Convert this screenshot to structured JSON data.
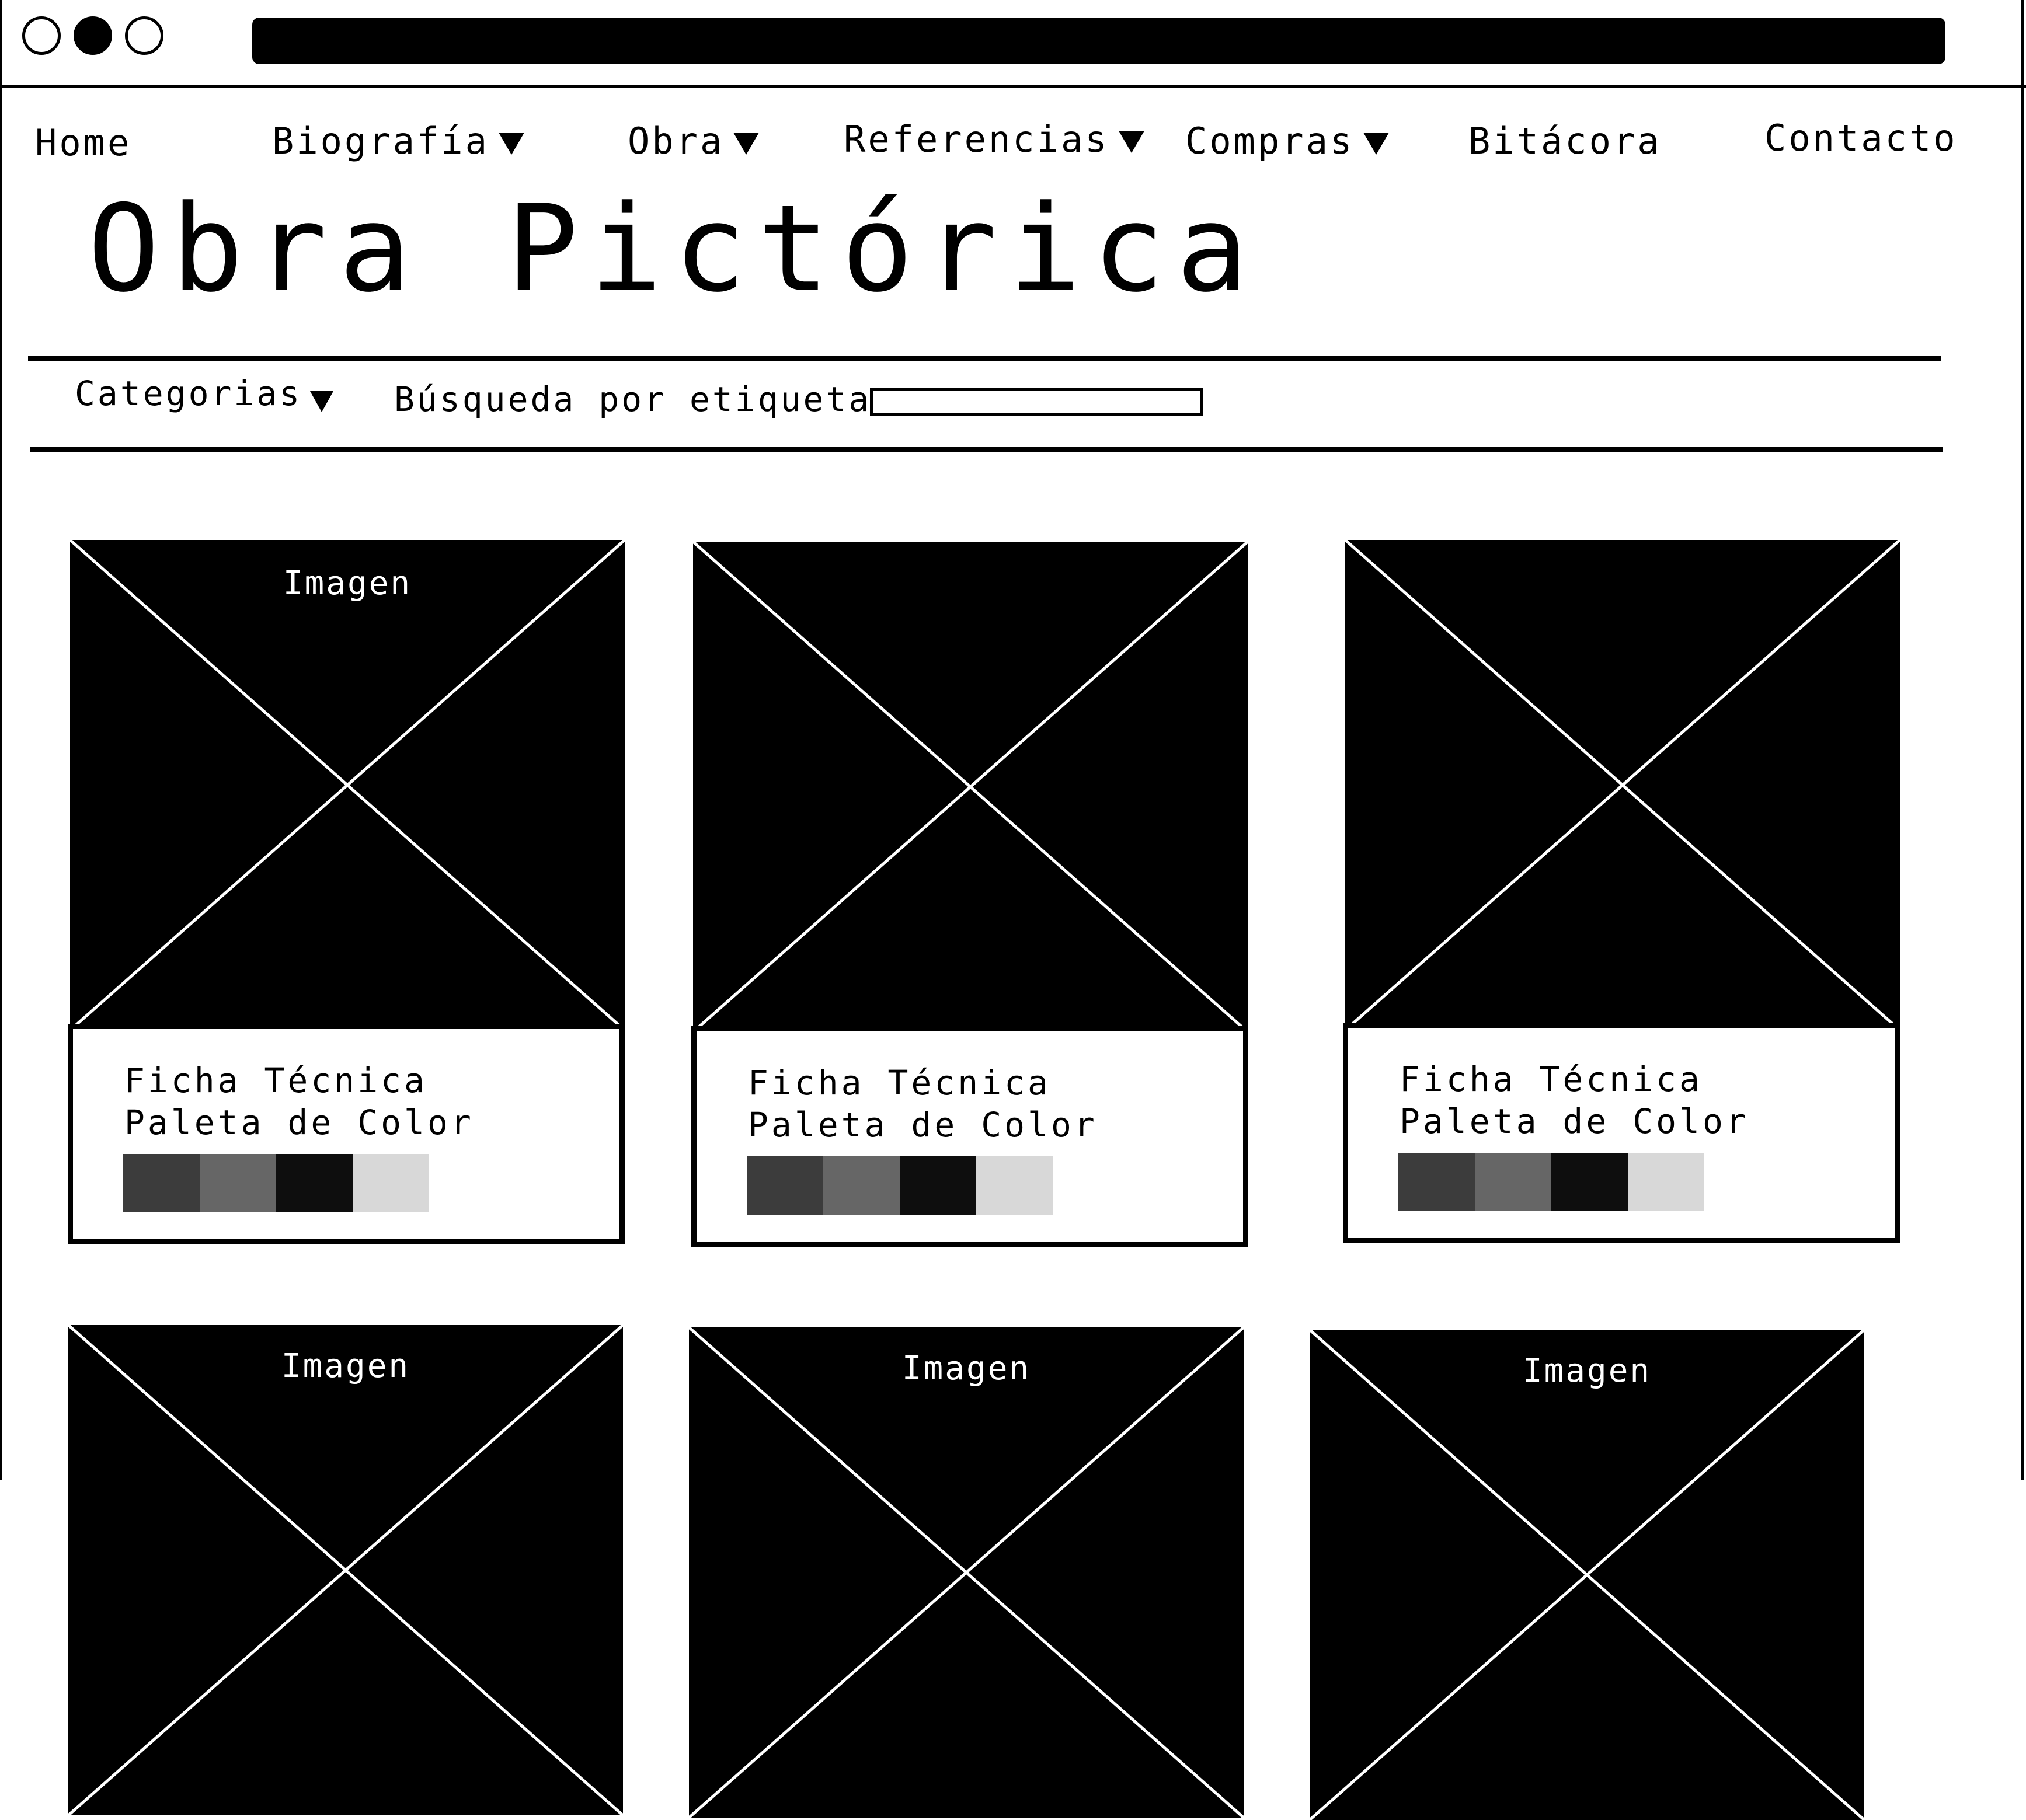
{
  "nav": {
    "home": "Home",
    "biografia": "Biografía",
    "obra": "Obra",
    "referencias": "Referencias",
    "compras": "Compras",
    "bitacora": "Bitácora",
    "contacto": "Contacto"
  },
  "page": {
    "title": "Obra Pictórica"
  },
  "filters": {
    "categories_label": "Categorias",
    "search_label": "Búsqueda por etiquetas",
    "search_value": ""
  },
  "cards": [
    {
      "image_label": "Imagen",
      "ficha": "Ficha Técnica",
      "paleta": "Paleta de Color"
    },
    {
      "image_label": "",
      "ficha": "Ficha Técnica",
      "paleta": "Paleta de Color"
    },
    {
      "image_label": "",
      "ficha": "Ficha Técnica",
      "paleta": "Paleta de Color"
    },
    {
      "image_label": "Imagen"
    },
    {
      "image_label": "Imagen"
    },
    {
      "image_label": "Imagen"
    }
  ],
  "palette_colors": [
    "#3c3c3c",
    "#666666",
    "#0e0e0e",
    "#d8d8d8"
  ]
}
